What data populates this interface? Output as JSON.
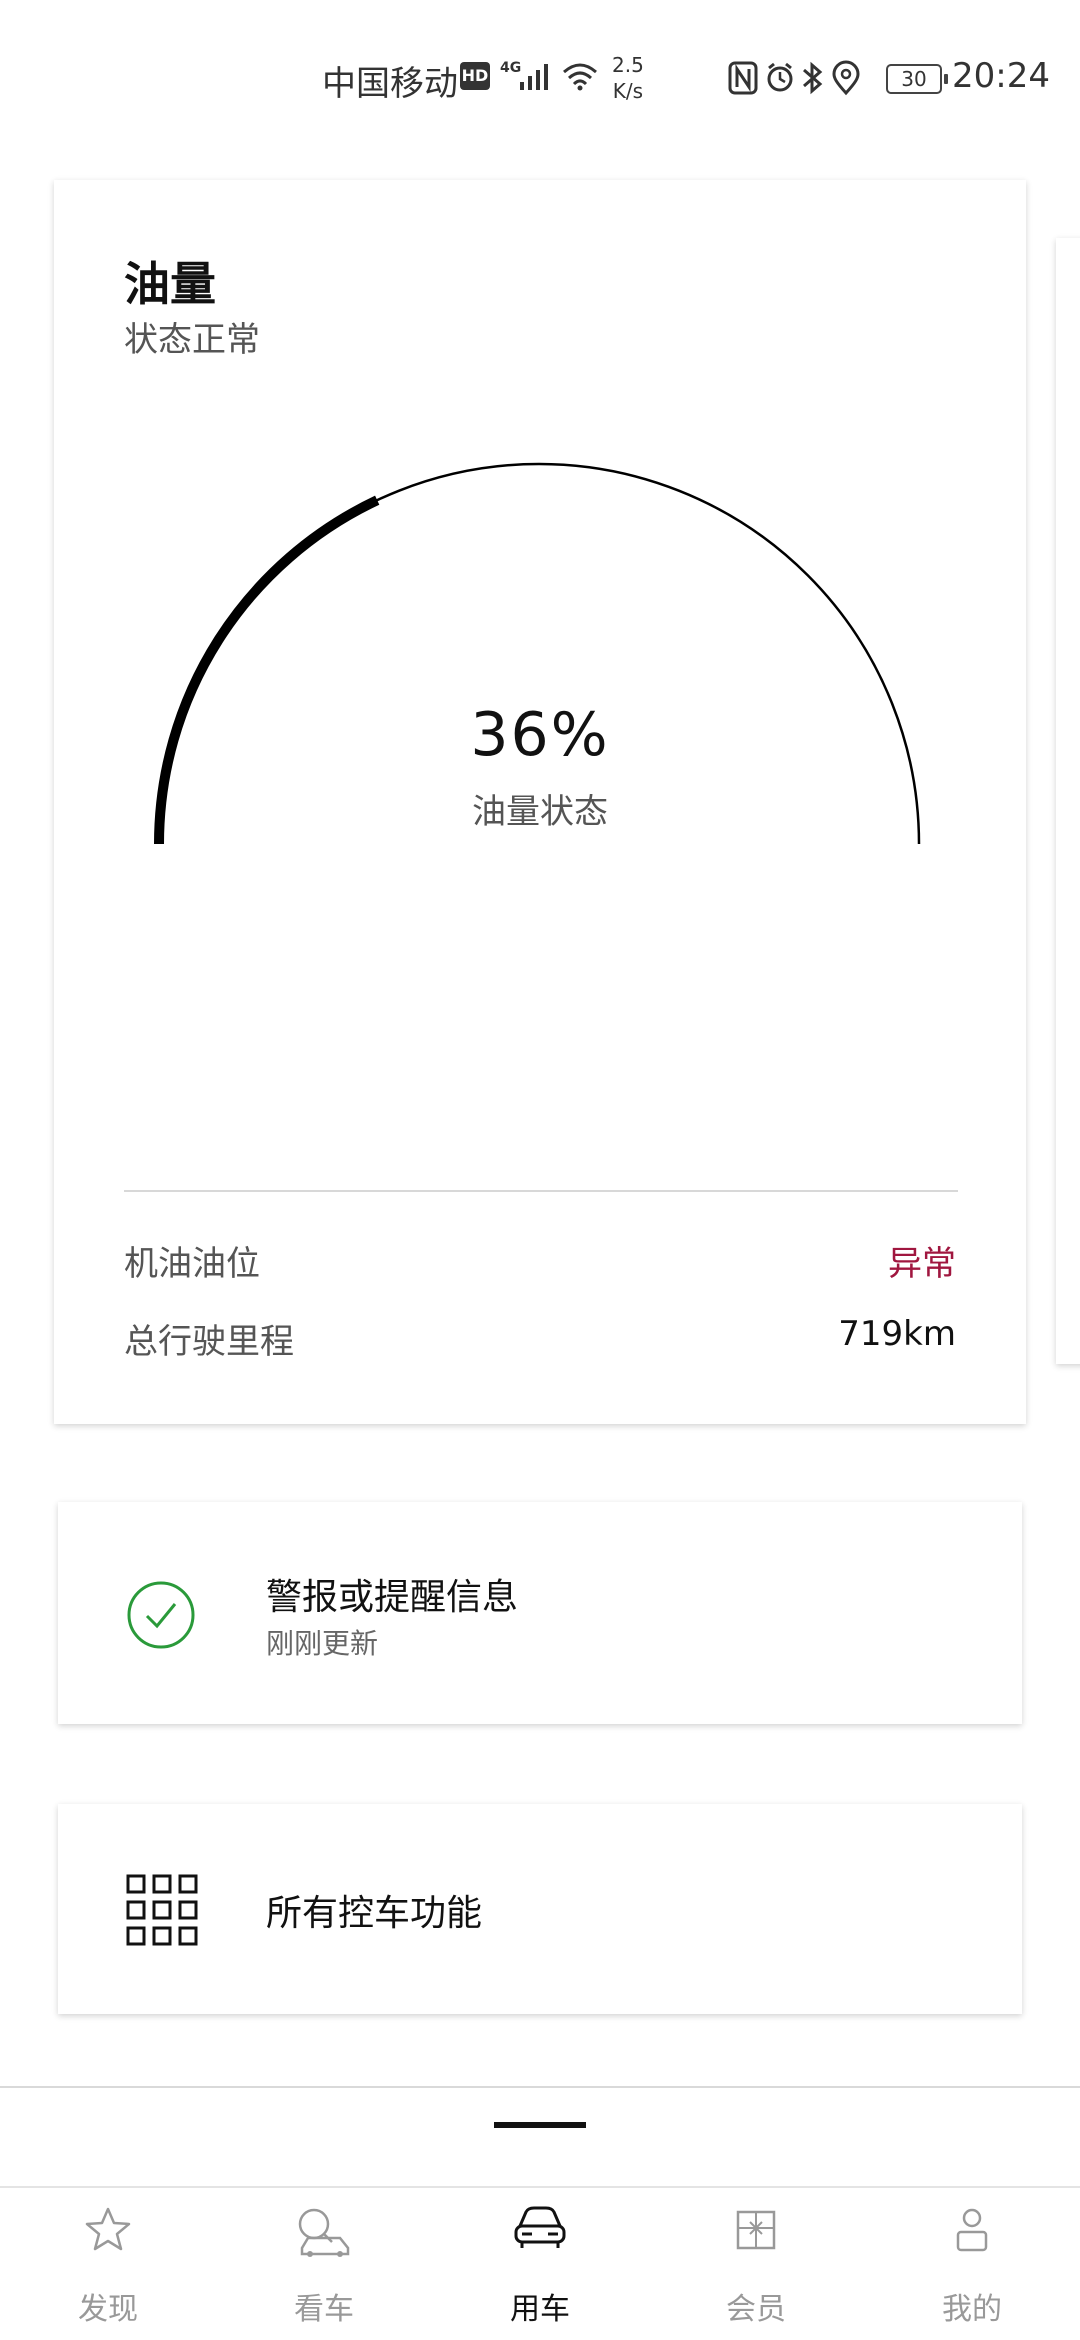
{
  "status_bar": {
    "carrier": "中国移动",
    "hd_badge": "HD",
    "network": "4G",
    "speed_value": "2.5",
    "speed_unit": "K/s",
    "battery": "30",
    "time": "20:24",
    "icons": [
      "nfc-icon",
      "alarm-icon",
      "bluetooth-icon",
      "location-icon"
    ]
  },
  "fuel_card": {
    "title": "油量",
    "subtitle": "状态正常",
    "gauge_value": "36%",
    "gauge_fraction": 0.36,
    "gauge_label": "油量状态",
    "rows": [
      {
        "label": "机油油位",
        "value": "异常",
        "status": "warning"
      },
      {
        "label": "总行驶里程",
        "value": "719km",
        "status": "normal"
      }
    ]
  },
  "alert_card": {
    "title": "警报或提醒信息",
    "subtitle": "刚刚更新",
    "icon": "check-circle-icon"
  },
  "function_card": {
    "title": "所有控车功能",
    "icon": "grid-icon"
  },
  "bottom_nav": {
    "active_index": 2,
    "items": [
      {
        "label": "发现",
        "icon": "star-icon"
      },
      {
        "label": "看车",
        "icon": "car-search-icon"
      },
      {
        "label": "用车",
        "icon": "car-front-icon"
      },
      {
        "label": "会员",
        "icon": "gift-icon"
      },
      {
        "label": "我的",
        "icon": "person-icon"
      }
    ]
  },
  "colors": {
    "warning": "#a0163f",
    "success": "#2a9a3a",
    "gauge": "#000000"
  }
}
